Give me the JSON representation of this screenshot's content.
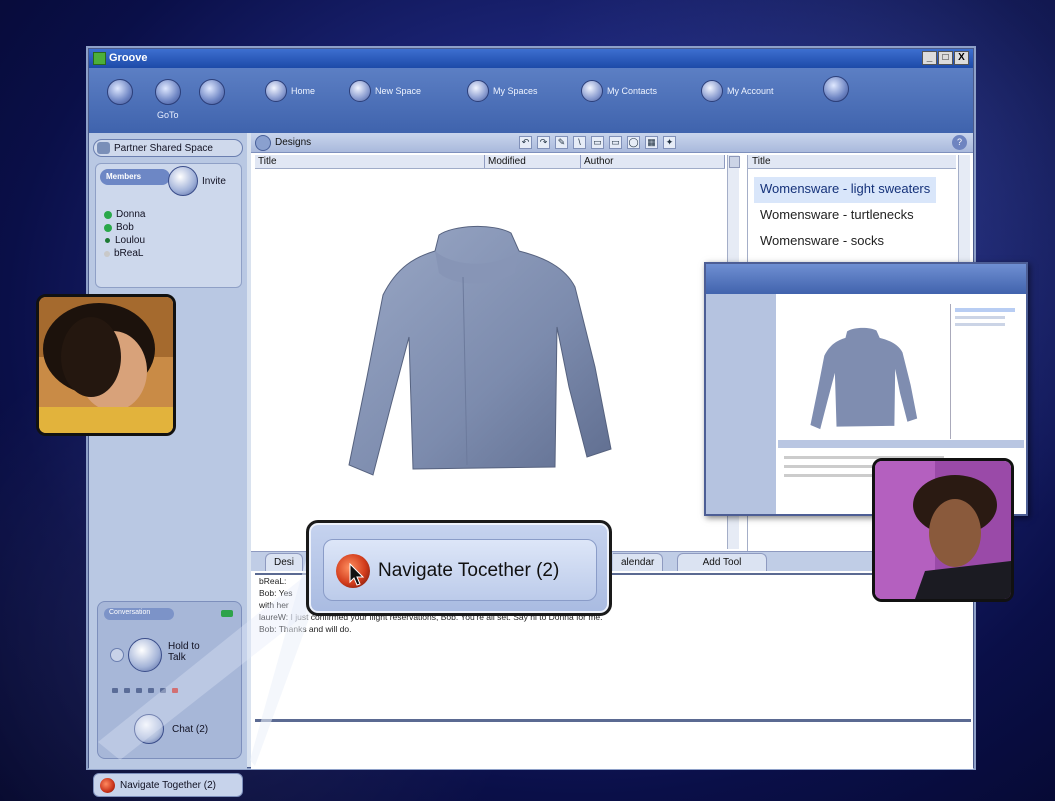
{
  "window": {
    "title": "Groove",
    "controls": [
      "_",
      "□",
      "X"
    ]
  },
  "toolbar": {
    "nav": [
      {
        "label": "",
        "icon": "back-arrow-icon"
      },
      {
        "label": "GoTo",
        "icon": "goto-icon"
      },
      {
        "label": "",
        "icon": "forward-icon"
      }
    ],
    "buttons": [
      {
        "label": "Home",
        "icon": "home-icon"
      },
      {
        "label": "New Space",
        "icon": "new-space-icon"
      },
      {
        "label": "My Spaces",
        "icon": "my-spaces-icon"
      },
      {
        "label": "My Contacts",
        "icon": "my-contacts-icon"
      },
      {
        "label": "My Account",
        "icon": "my-account-icon"
      }
    ]
  },
  "sidebar": {
    "space_name": "Partner Shared Space",
    "members_header": "Members",
    "invite_label": "Invite",
    "members": [
      {
        "name": "Donna",
        "status_color": "#2aa84a"
      },
      {
        "name": "Bob",
        "status_color": "#2aa84a"
      },
      {
        "name": "Loulou",
        "status_color": "#1e7a34"
      },
      {
        "name": "bReaL",
        "status_color": "#c9c9c9"
      }
    ],
    "conversation_header": "Conversation",
    "hold_to_talk": "Hold to Talk",
    "chat_label": "Chat (2)",
    "navigate_label": "Navigate Together (2)"
  },
  "tool": {
    "name": "Designs",
    "columns": [
      "Title",
      "Modified",
      "Author"
    ],
    "toolbar_icons": [
      "↶",
      "↷",
      "✎",
      "\\",
      "▭",
      "▭",
      "◯",
      "▦",
      "✦"
    ],
    "right_header": "Title",
    "items": [
      {
        "label": "Womensware - light sweaters",
        "selected": true
      },
      {
        "label": "Womensware - turtlenecks",
        "selected": false
      },
      {
        "label": "Womensware - socks",
        "selected": false
      }
    ],
    "help": "?"
  },
  "tabs": [
    {
      "label": "Desi"
    },
    {
      "label": "alendar"
    },
    {
      "label": "Add Tool"
    }
  ],
  "chat": {
    "lines": [
      "bReaL:",
      "Bob: Yes                                                           review some new designs",
      "with her",
      "laureW: I just confirmed your flight reservations, Bob.  You're all set.  Say hi to Donna for me.",
      "Bob: Thanks and will do."
    ]
  },
  "callout": {
    "label": "Navigate Tocether (2)"
  },
  "colors": {
    "window_bg": "#d9e2ef",
    "toolbar": "#4f72bb",
    "selection": "#d9e6fa",
    "online": "#2aa84a"
  }
}
